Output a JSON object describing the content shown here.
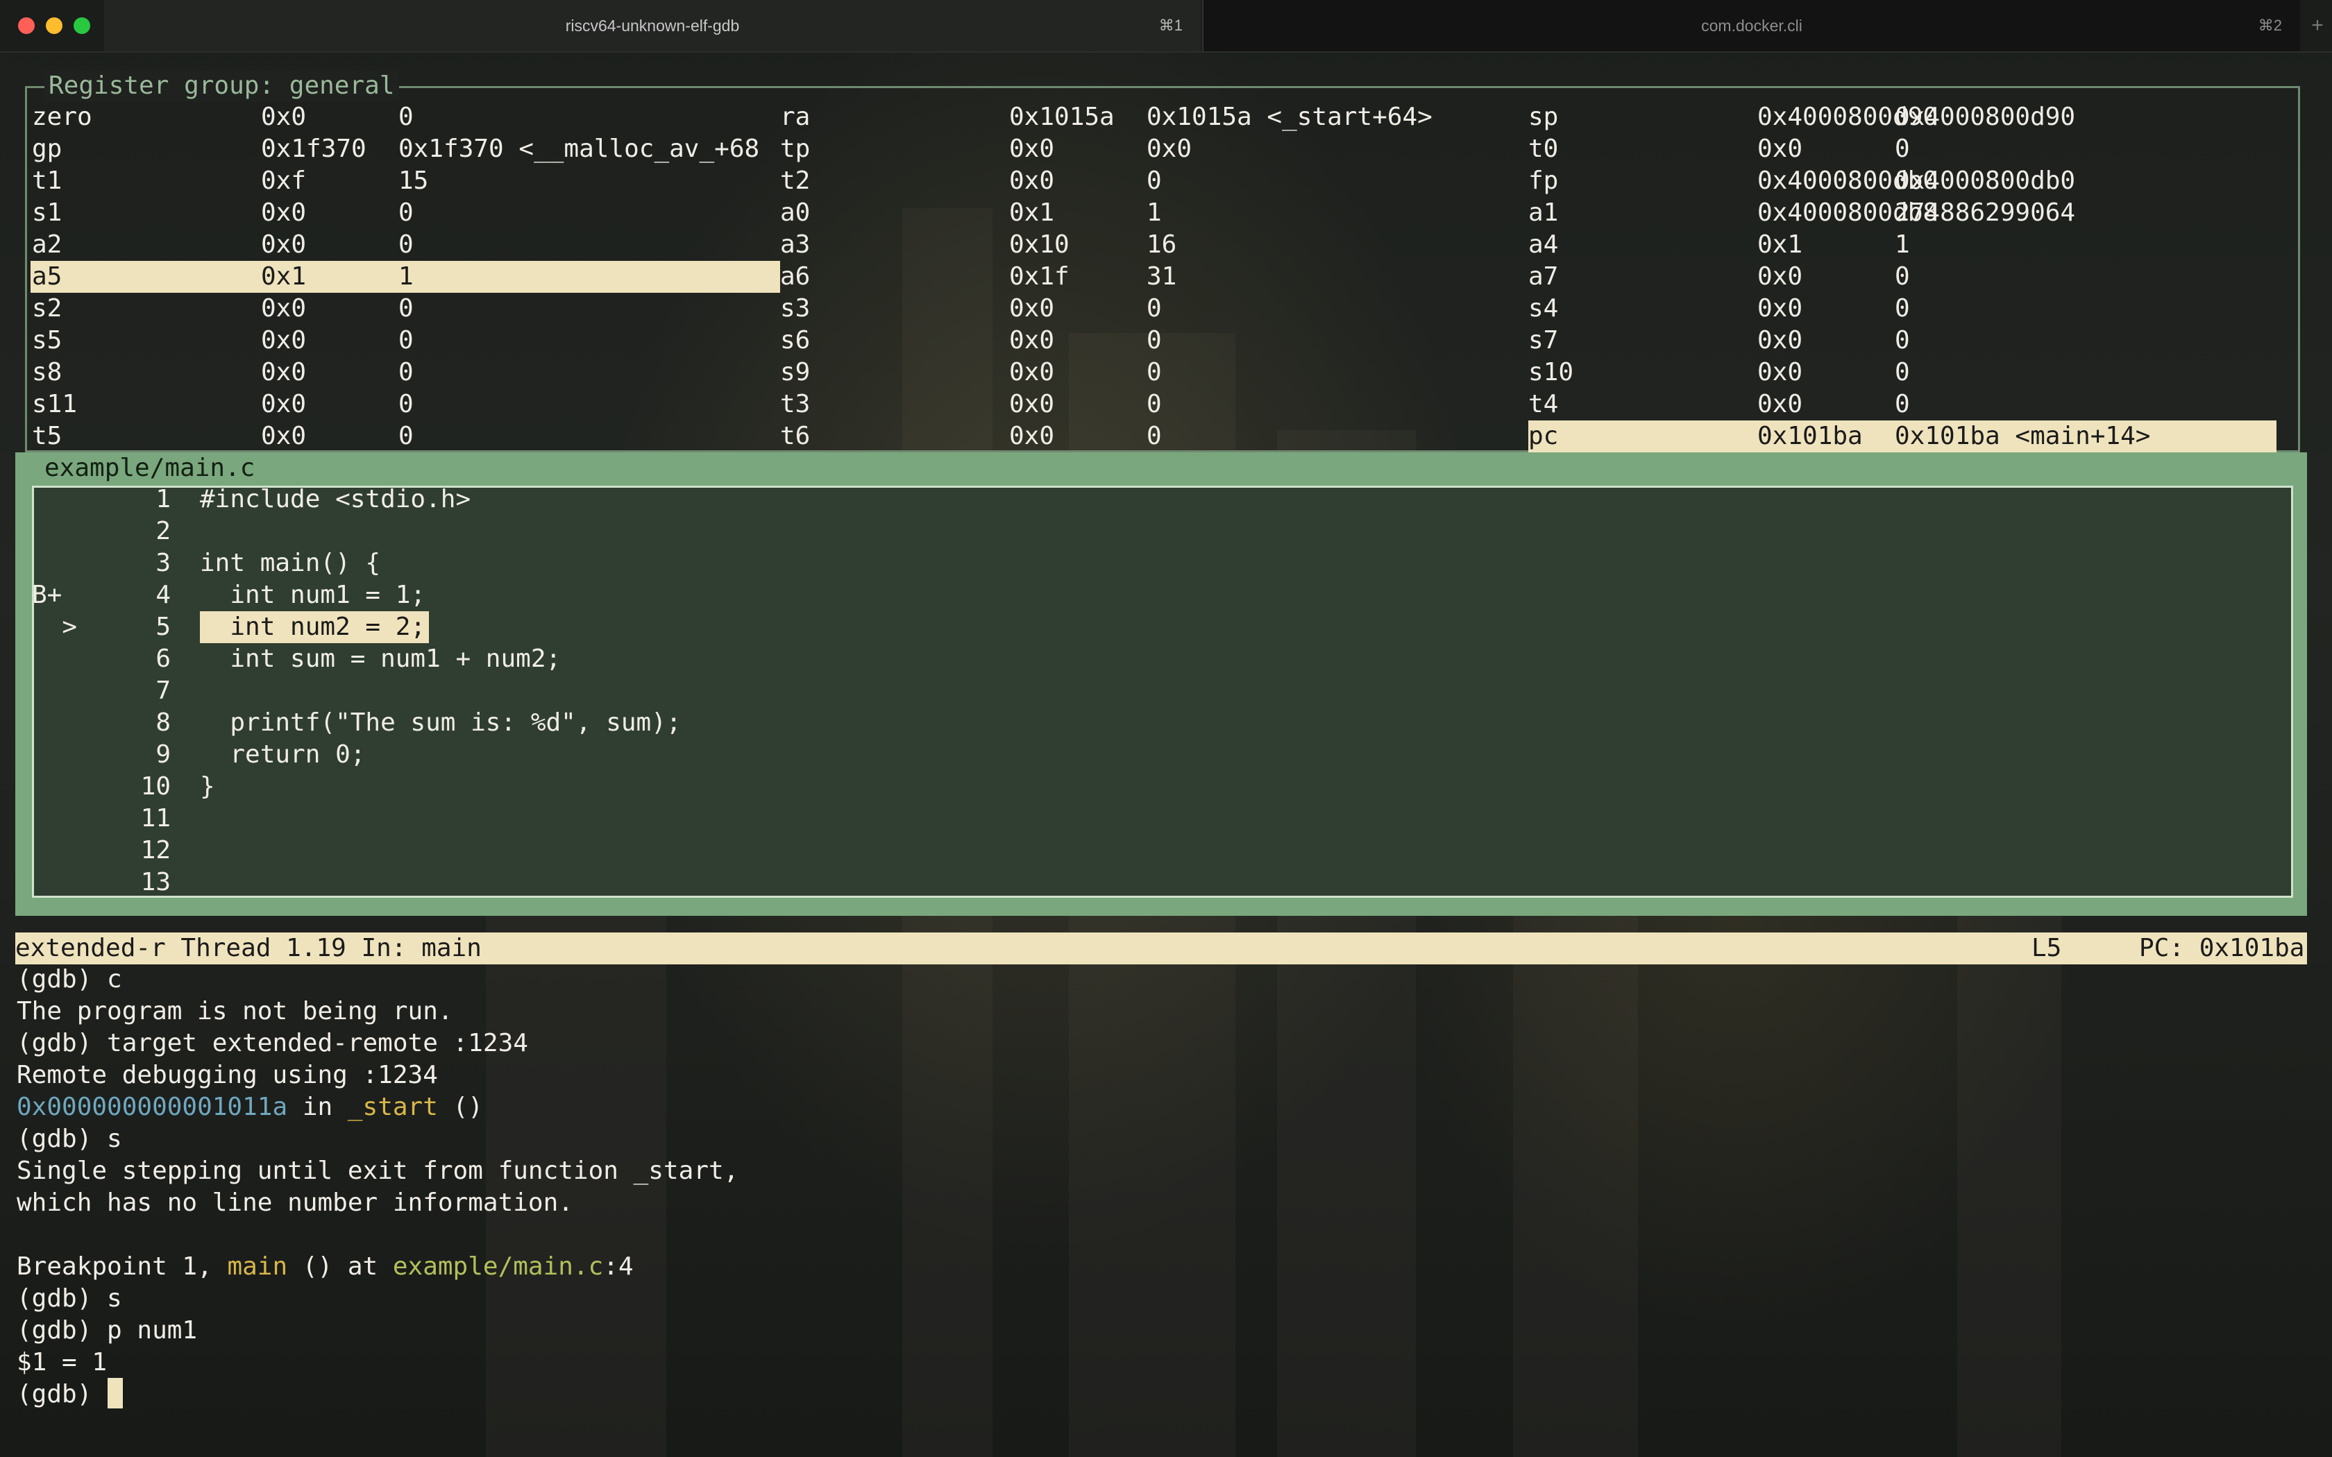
{
  "window": {
    "tabs": [
      {
        "title": "riscv64-unknown-elf-gdb",
        "shortcut": "⌘1"
      },
      {
        "title": "com.docker.cli",
        "shortcut": "⌘2"
      }
    ],
    "new_tab_icon": "+"
  },
  "registers": {
    "title": "Register group: general",
    "highlighted": [
      "a5",
      "pc"
    ],
    "columns": [
      [
        {
          "name": "zero",
          "hex": "0x0",
          "val": "0"
        },
        {
          "name": "gp",
          "hex": "0x1f370",
          "val": "0x1f370 <__malloc_av_+68"
        },
        {
          "name": "t1",
          "hex": "0xf",
          "val": "15"
        },
        {
          "name": "s1",
          "hex": "0x0",
          "val": "0"
        },
        {
          "name": "a2",
          "hex": "0x0",
          "val": "0"
        },
        {
          "name": "a5",
          "hex": "0x1",
          "val": "1"
        },
        {
          "name": "s2",
          "hex": "0x0",
          "val": "0"
        },
        {
          "name": "s5",
          "hex": "0x0",
          "val": "0"
        },
        {
          "name": "s8",
          "hex": "0x0",
          "val": "0"
        },
        {
          "name": "s11",
          "hex": "0x0",
          "val": "0"
        },
        {
          "name": "t5",
          "hex": "0x0",
          "val": "0"
        }
      ],
      [
        {
          "name": "ra",
          "hex": "0x1015a",
          "val": "0x1015a <_start+64>"
        },
        {
          "name": "tp",
          "hex": "0x0",
          "val": "0x0"
        },
        {
          "name": "t2",
          "hex": "0x0",
          "val": "0"
        },
        {
          "name": "a0",
          "hex": "0x1",
          "val": "1"
        },
        {
          "name": "a3",
          "hex": "0x10",
          "val": "16"
        },
        {
          "name": "a6",
          "hex": "0x1f",
          "val": "31"
        },
        {
          "name": "s3",
          "hex": "0x0",
          "val": "0"
        },
        {
          "name": "s6",
          "hex": "0x0",
          "val": "0"
        },
        {
          "name": "s9",
          "hex": "0x0",
          "val": "0"
        },
        {
          "name": "t3",
          "hex": "0x0",
          "val": "0"
        },
        {
          "name": "t6",
          "hex": "0x0",
          "val": "0"
        }
      ],
      [
        {
          "name": "sp",
          "hex": "0x4000800d90",
          "val": "0x4000800d90"
        },
        {
          "name": "t0",
          "hex": "0x0",
          "val": "0"
        },
        {
          "name": "fp",
          "hex": "0x4000800db0",
          "val": "0x4000800db0"
        },
        {
          "name": "a1",
          "hex": "0x4000800db8",
          "val": "274886299064"
        },
        {
          "name": "a4",
          "hex": "0x1",
          "val": "1"
        },
        {
          "name": "a7",
          "hex": "0x0",
          "val": "0"
        },
        {
          "name": "s4",
          "hex": "0x0",
          "val": "0"
        },
        {
          "name": "s7",
          "hex": "0x0",
          "val": "0"
        },
        {
          "name": "s10",
          "hex": "0x0",
          "val": "0"
        },
        {
          "name": "t4",
          "hex": "0x0",
          "val": "0"
        },
        {
          "name": "pc",
          "hex": "0x101ba",
          "val": "0x101ba <main+14>"
        }
      ]
    ]
  },
  "source": {
    "file": "example/main.c",
    "current_line": 5,
    "lines": [
      {
        "marker": "",
        "num": "1",
        "code": "#include <stdio.h>"
      },
      {
        "marker": "",
        "num": "2",
        "code": ""
      },
      {
        "marker": "",
        "num": "3",
        "code": "int main() {"
      },
      {
        "marker": "B+",
        "num": "4",
        "code": "  int num1 = 1;"
      },
      {
        "marker": "  >",
        "num": "5",
        "code": "  int num2 = 2;"
      },
      {
        "marker": "",
        "num": "6",
        "code": "  int sum = num1 + num2;"
      },
      {
        "marker": "",
        "num": "7",
        "code": ""
      },
      {
        "marker": "",
        "num": "8",
        "code": "  printf(\"The sum is: %d\", sum);"
      },
      {
        "marker": "",
        "num": "9",
        "code": "  return 0;"
      },
      {
        "marker": "",
        "num": "10",
        "code": "}"
      },
      {
        "marker": "",
        "num": "11",
        "code": ""
      },
      {
        "marker": "",
        "num": "12",
        "code": ""
      },
      {
        "marker": "",
        "num": "13",
        "code": ""
      }
    ]
  },
  "status": {
    "left": "extended-r Thread 1.19 In: main",
    "line": "L5",
    "pc": "PC: 0x101ba"
  },
  "console": {
    "lines": [
      [
        {
          "t": "(gdb) c"
        }
      ],
      [
        {
          "t": "The program is not being run."
        }
      ],
      [
        {
          "t": "(gdb) target extended-remote :1234"
        }
      ],
      [
        {
          "t": "Remote debugging using :1234"
        }
      ],
      [
        {
          "t": "0x000000000001011a",
          "c": "blue"
        },
        {
          "t": " in "
        },
        {
          "t": "_start",
          "c": "yellow"
        },
        {
          "t": " ()"
        }
      ],
      [
        {
          "t": "(gdb) s"
        }
      ],
      [
        {
          "t": "Single stepping until exit from function _start,"
        }
      ],
      [
        {
          "t": "which has no line number information."
        }
      ],
      [
        {
          "t": ""
        }
      ],
      [
        {
          "t": "Breakpoint 1, "
        },
        {
          "t": "main",
          "c": "yellow"
        },
        {
          "t": " () at "
        },
        {
          "t": "example/main.c",
          "c": "green"
        },
        {
          "t": ":4"
        }
      ],
      [
        {
          "t": "(gdb) s"
        }
      ],
      [
        {
          "t": "(gdb) p num1"
        }
      ],
      [
        {
          "t": "$1 = 1"
        }
      ],
      [
        {
          "t": "(gdb) "
        }
      ]
    ]
  },
  "colors": {
    "highlight": "#efe3bd",
    "source_border": "#7aa77d",
    "register_border": "#6e8a70",
    "address": "#6fa8c0",
    "function": "#d9b748",
    "filename": "#b4c05a"
  }
}
